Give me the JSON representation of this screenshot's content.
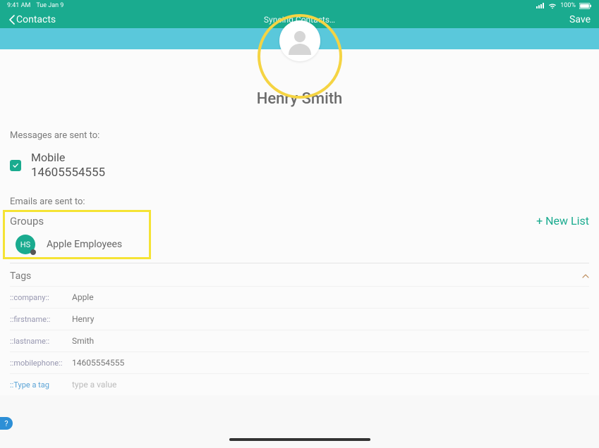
{
  "status": {
    "time": "9:41 AM",
    "date": "Tue Jan 9",
    "battery": "100%"
  },
  "topbar": {
    "back_label": "Contacts",
    "center": "Syncing Contacts…",
    "save": "Save"
  },
  "profile": {
    "name": "Henry  Smith"
  },
  "messages": {
    "label": "Messages are sent to:",
    "mobile_label": "Mobile",
    "mobile_number": "14605554555"
  },
  "emails": {
    "label": "Emails are sent to:"
  },
  "groups": {
    "title": "Groups",
    "new_list": "+ New List",
    "item_badge": "HS",
    "item_name": "Apple Employees"
  },
  "tags": {
    "title": "Tags",
    "rows": [
      {
        "key": "::company::",
        "val": "Apple"
      },
      {
        "key": "::firstname::",
        "val": "Henry"
      },
      {
        "key": "::lastname::",
        "val": "Smith"
      },
      {
        "key": "::mobilephone::",
        "val": "14605554555"
      }
    ],
    "placeholder_key": "::Type a tag",
    "placeholder_val": "type a value"
  },
  "help": "?"
}
